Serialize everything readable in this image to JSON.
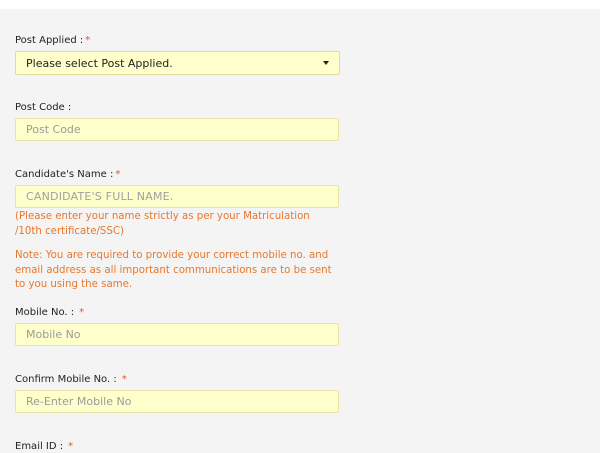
{
  "form": {
    "post_applied": {
      "label": "Post Applied :",
      "required_mark": "*",
      "selected": "Please select Post Applied."
    },
    "post_code": {
      "label": "Post Code :",
      "placeholder": "Post Code"
    },
    "candidate_name": {
      "label": "Candidate's Name :",
      "required_mark": "*",
      "placeholder": "CANDIDATE'S FULL NAME.",
      "hint": "(Please enter your name strictly as per your Matriculation /10th certificate/SSC)"
    },
    "note": "Note: You are required to provide your correct mobile no. and email address as all important communications are to be sent to you using the same.",
    "mobile": {
      "label": "Mobile No. :",
      "required_mark": "*",
      "placeholder": "Mobile No"
    },
    "confirm_mobile": {
      "label": "Confirm Mobile No. :",
      "required_mark": "*",
      "placeholder": "Re-Enter Mobile No"
    },
    "email": {
      "label": "Email ID :",
      "required_mark": "*"
    }
  },
  "colors": {
    "field_background": "#ffffcc",
    "field_border": "#e8e3a6",
    "required_mark": "#e0572a",
    "note_text": "#e8772e",
    "page_background": "#f4f4f4"
  }
}
